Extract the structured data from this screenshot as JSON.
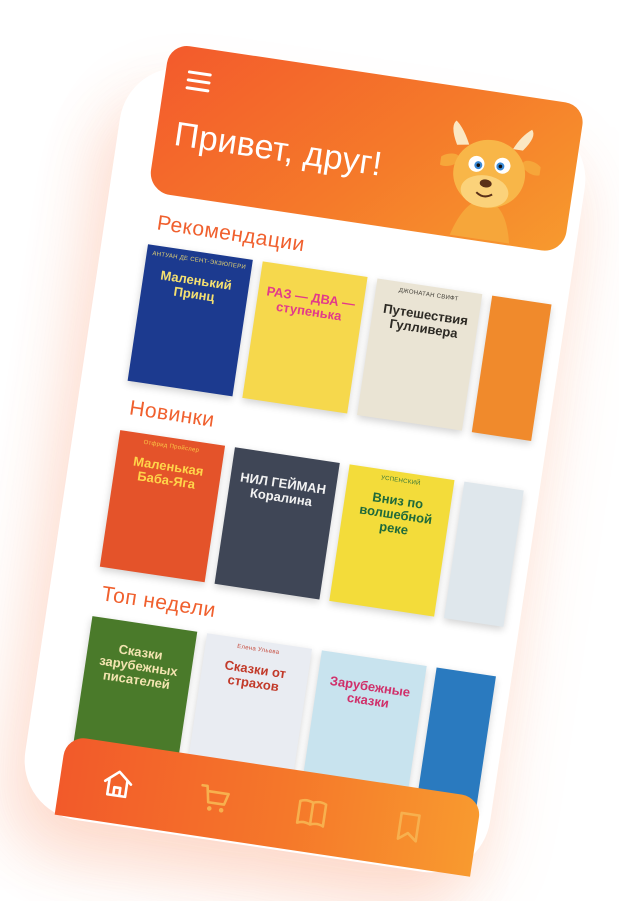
{
  "header": {
    "greeting": "Привет, друг!",
    "menu_icon": "hamburger-menu-icon",
    "mascot": "goat-mascot"
  },
  "sections": [
    {
      "title": "Рекомендации",
      "books": [
        {
          "author": "АНТУАН ДЕ СЕНТ-ЭКЗЮПЕРИ",
          "title": "Маленький Принц",
          "bg": "#1c3a8f",
          "fg": "#f5e070"
        },
        {
          "author": "",
          "title": "РАЗ — ДВА — ступенька",
          "bg": "#f6d84c",
          "fg": "#e23a8a"
        },
        {
          "author": "ДЖОНАТАН СВИФТ",
          "title": "Путешествия Гулливера",
          "bg": "#eae4d4",
          "fg": "#2d2a24"
        },
        {
          "author": "",
          "title": "",
          "bg": "#f08a2c",
          "fg": "#1c4a9c"
        }
      ]
    },
    {
      "title": "Новинки",
      "books": [
        {
          "author": "Отфрид Пройслер",
          "title": "Маленькая Баба-Яга",
          "bg": "#e4532a",
          "fg": "#ffd54a"
        },
        {
          "author": "",
          "title": "НИЛ ГЕЙМАН Коралина",
          "bg": "#3f4656",
          "fg": "#f2f2f2"
        },
        {
          "author": "УСПЕНСКИЙ",
          "title": "Вниз по волшебной реке",
          "bg": "#f3dc3a",
          "fg": "#1f6a3a"
        },
        {
          "author": "",
          "title": "",
          "bg": "#dfe7ec",
          "fg": "#b8467a"
        }
      ]
    },
    {
      "title": "Топ недели",
      "books": [
        {
          "author": "",
          "title": "Сказки зарубежных писателей",
          "bg": "#4a7a2a",
          "fg": "#f3e4b0"
        },
        {
          "author": "Елена Ульева",
          "title": "Сказки от страхов",
          "bg": "#e9ecf2",
          "fg": "#c23a2a"
        },
        {
          "author": "",
          "title": "Зарубежные сказки",
          "bg": "#c8e3ee",
          "fg": "#d0306a"
        },
        {
          "author": "",
          "title": "",
          "bg": "#2a7abf",
          "fg": "#ffffff"
        }
      ]
    }
  ],
  "tabbar": {
    "tabs": [
      {
        "icon": "home-icon",
        "active": true
      },
      {
        "icon": "cart-icon",
        "active": false
      },
      {
        "icon": "book-icon",
        "active": false
      },
      {
        "icon": "bookmark-icon",
        "active": false
      }
    ]
  },
  "colors": {
    "accent": "#f35a2c",
    "accent_light": "#f89a2f",
    "section_title": "#f0602e",
    "tab_active": "#ffffff",
    "tab_inactive": "#f7b04e"
  }
}
